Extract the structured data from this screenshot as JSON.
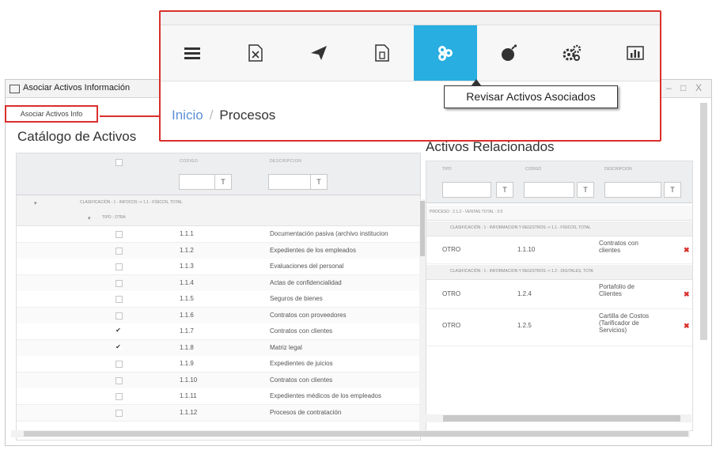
{
  "window": {
    "title": "Asociar Activos Información",
    "minimize": "–",
    "maximize": "□",
    "close": "X"
  },
  "toolbar": {
    "assoc_button": "Asociar Activos Info"
  },
  "navbar": {
    "icons": [
      "menu-icon",
      "excel-icon",
      "send-icon",
      "document-icon",
      "assets-icon",
      "bomb-icon",
      "gears-icon",
      "chart-icon"
    ],
    "active_index": 4,
    "tooltip": "Revisar Activos Asociados",
    "accent_color": "#28aee0"
  },
  "breadcrumb": {
    "home": "Inicio",
    "separator": "/",
    "current": "Procesos"
  },
  "catalog": {
    "title": "Catálogo de Activos",
    "columns": [
      "CODIGO",
      "DESCRIPCION"
    ],
    "filter_button": "T",
    "group1": "CLASIFICACIÓN : 1 - INFOCOS -> 1.1 - FÍSICOS, TOTAL",
    "group2": "TIPO : OTRA",
    "rows": [
      {
        "checked": false,
        "code": "1.1.1",
        "desc": "Documentación pasiva (archivo institucion"
      },
      {
        "checked": false,
        "code": "1.1.2",
        "desc": "Expedientes de los empleados"
      },
      {
        "checked": false,
        "code": "1.1.3",
        "desc": "Evaluaciones del personal"
      },
      {
        "checked": false,
        "code": "1.1.4",
        "desc": "Actas de confidencialidad"
      },
      {
        "checked": false,
        "code": "1.1.5",
        "desc": "Seguros de bienes"
      },
      {
        "checked": false,
        "code": "1.1.6",
        "desc": "Contratos con proveedores"
      },
      {
        "checked": true,
        "code": "1.1.7",
        "desc": "Contratos con clientes"
      },
      {
        "checked": true,
        "code": "1.1.8",
        "desc": "Matriz legal"
      },
      {
        "checked": false,
        "code": "1.1.9",
        "desc": "Expedientes de juicios"
      },
      {
        "checked": false,
        "code": "1.1.10",
        "desc": "Contratos con clientes"
      },
      {
        "checked": false,
        "code": "1.1.11",
        "desc": "Expedientes médicos de los empleados"
      },
      {
        "checked": false,
        "code": "1.1.12",
        "desc": "Procesos de contratación"
      }
    ]
  },
  "related": {
    "title": "Activos Relacionados",
    "columns": [
      "TIPO",
      "CODIGO",
      "DESCRIPCION"
    ],
    "filter_button": "T",
    "process_group": "PROCESO : 2.1.2 - VENTAS TOTAL : 3.0",
    "groupA": "CLASIFICACIÓN : 1 - INFORMACION Y REGISTROS -> 1.1 - FÍSICOS, TOTAL",
    "groupB": "CLASIFICACIÓN : 1 - INFORMACION Y REGISTROS -> 1.2 - DIGITALES, TOTA",
    "rowsA": [
      {
        "tipo": "OTRO",
        "code": "1.1.10",
        "desc": "Contratos con clientes"
      }
    ],
    "rowsB": [
      {
        "tipo": "OTRO",
        "code": "1.2.4",
        "desc": "Portafolio de Clientes"
      },
      {
        "tipo": "OTRO",
        "code": "1.2.5",
        "desc": "Cartilla de Costos (Tarificador de Servicios)"
      }
    ],
    "delete_glyph": "✖"
  }
}
